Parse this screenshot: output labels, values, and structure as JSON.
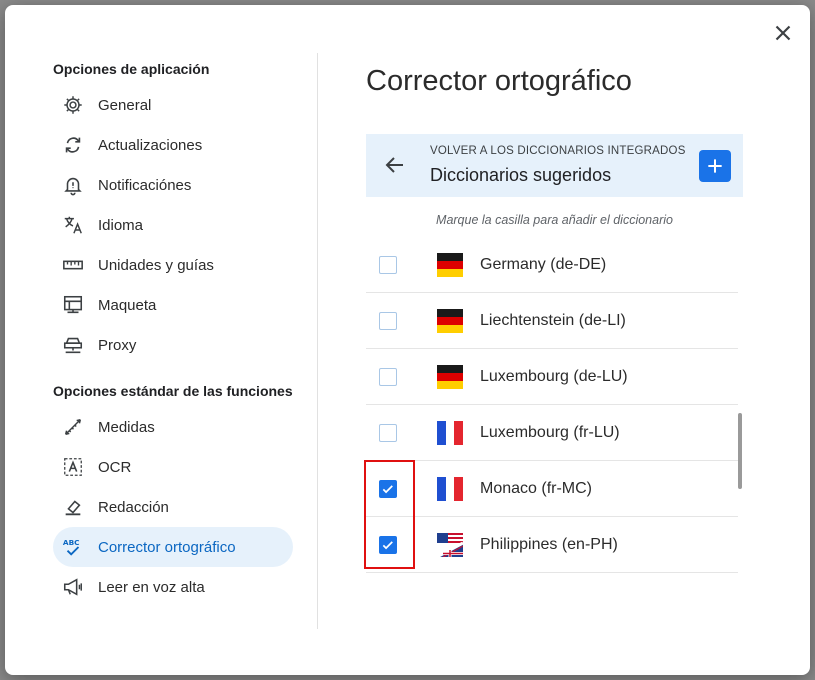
{
  "dialog": {
    "title": "Corrector ortográfico",
    "close_icon": "close-icon"
  },
  "sidebar": {
    "section_app": "Opciones de aplicación",
    "app_items": [
      {
        "label": "General",
        "icon": "gear-icon"
      },
      {
        "label": "Actualizaciones",
        "icon": "sync-icon"
      },
      {
        "label": "Notificaciónes",
        "icon": "bell-icon"
      },
      {
        "label": "Idioma",
        "icon": "translate-icon"
      },
      {
        "label": "Unidades y guías",
        "icon": "ruler-icon"
      },
      {
        "label": "Maqueta",
        "icon": "layout-icon"
      },
      {
        "label": "Proxy",
        "icon": "network-icon"
      }
    ],
    "section_features": "Opciones estándar de las funciones",
    "feature_items": [
      {
        "label": "Medidas",
        "icon": "measure-icon"
      },
      {
        "label": "OCR",
        "icon": "ocr-icon"
      },
      {
        "label": "Redacción",
        "icon": "eraser-icon"
      },
      {
        "label": "Corrector ortográfico",
        "icon": "spellcheck-icon",
        "active": true
      },
      {
        "label": "Leer en voz alta",
        "icon": "megaphone-icon"
      }
    ]
  },
  "panel": {
    "back_caption": "VOLVER A LOS DICCIONARIOS INTEGRADOS",
    "back_title": "Diccionarios sugeridos",
    "hint": "Marque la casilla para añadir el diccionario"
  },
  "dictionaries": [
    {
      "label": "Germany (de-DE)",
      "flag": "germany-flag",
      "checked": false
    },
    {
      "label": "Liechtenstein (de-LI)",
      "flag": "germany-flag",
      "checked": false
    },
    {
      "label": "Luxembourg (de-LU)",
      "flag": "germany-flag",
      "checked": false
    },
    {
      "label": "Luxembourg (fr-LU)",
      "flag": "france-flag",
      "checked": false
    },
    {
      "label": "Monaco (fr-MC)",
      "flag": "france-flag",
      "checked": true
    },
    {
      "label": "Philippines (en-PH)",
      "flag": "us-uk-flag",
      "checked": true
    }
  ],
  "colors": {
    "accent": "#1a73e8",
    "active_bg": "#e6f1fb",
    "highlight": "#e01010"
  }
}
